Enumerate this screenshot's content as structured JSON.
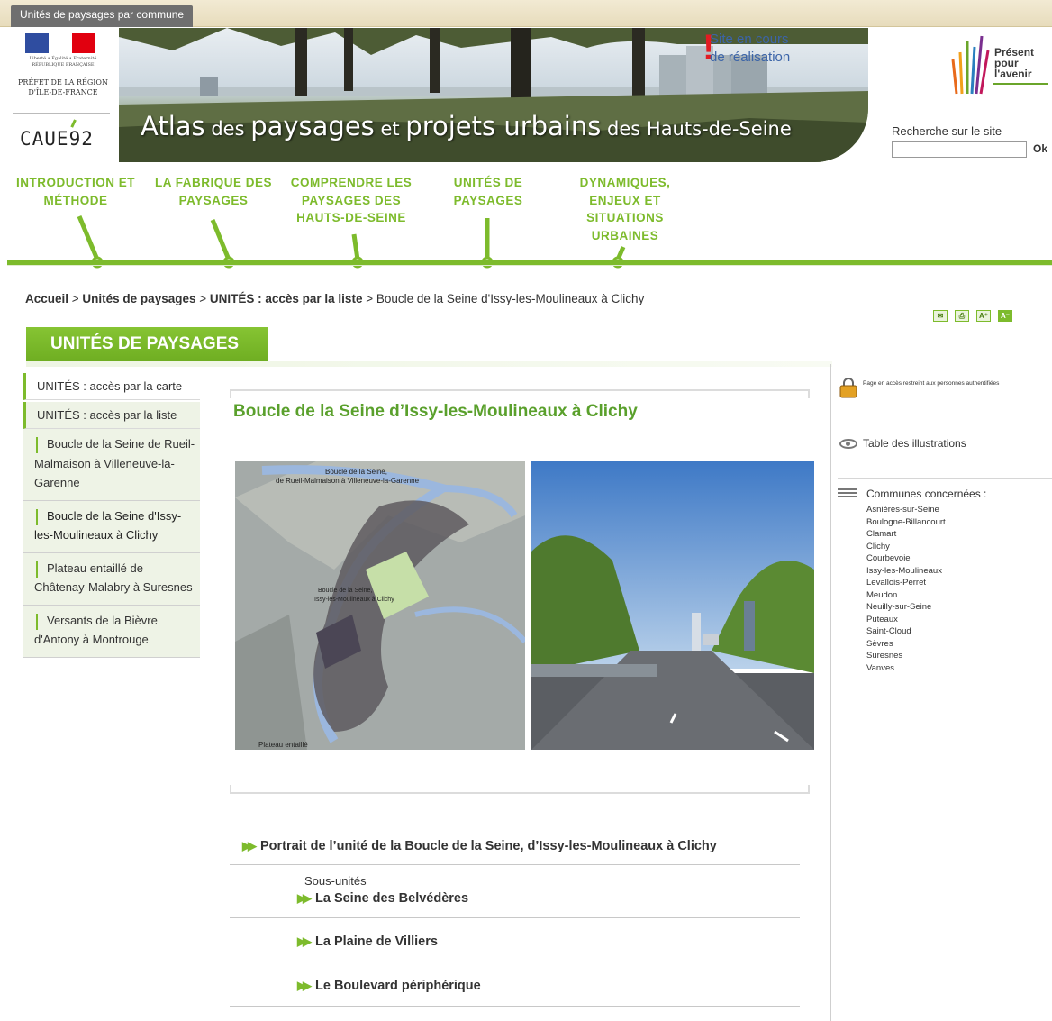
{
  "top_tab": "Unités de paysages par commune",
  "logo": {
    "motto": "Liberté • Égalité • Fraternité",
    "rf": "RÉPUBLIQUE FRANÇAISE",
    "prefet": "PRÉFET DE LA RÉGION D'ÎLE-DE-FRANCE",
    "caue": "CAUE92"
  },
  "banner": {
    "w1": "Atlas",
    "w2": " des ",
    "w3": "paysages",
    "w4": " et ",
    "w5": "projets urbains",
    "w6": " des Hauts-de-Seine",
    "notice_line1": "Site en cours",
    "notice_line2": "de réalisation"
  },
  "present": {
    "l1": "Présent",
    "l2": "pour",
    "l3": "l'avenir"
  },
  "search": {
    "label": "Recherche sur le site",
    "value": "",
    "ok": "Ok"
  },
  "nav": [
    {
      "l1": "INTRODUCTION ET",
      "l2": "MÉTHODE"
    },
    {
      "l1": "LA FABRIQUE DES",
      "l2": "PAYSAGES"
    },
    {
      "l1": "COMPRENDRE LES",
      "l2": "PAYSAGES DES",
      "l3": "HAUTS-DE-SEINE"
    },
    {
      "l1": "UNITÉS DE",
      "l2": "PAYSAGES"
    },
    {
      "l1": "DYNAMIQUES,",
      "l2": "ENJEUX ET",
      "l3": "SITUATIONS",
      "l4": "URBAINES"
    }
  ],
  "breadcrumb": {
    "b1": "Accueil",
    "sep": " > ",
    "b2": "Unités de paysages",
    "b3": "UNITÉS : accès par la liste",
    "b4": "Boucle de la Seine d'Issy-les-Moulineaux à Clichy"
  },
  "tools": [
    "✉",
    "⎙",
    "A⁺",
    "A⁻"
  ],
  "section_title": "UNITÉS DE PAYSAGES",
  "sidebar": {
    "item1": "UNITÉS : accès par la carte",
    "item2": "UNITÉS : accès par la liste",
    "sub": [
      "Boucle de la Seine de Rueil-Malmaison à Villeneuve-la-Garenne",
      "Boucle de la Seine d'Issy-les-Moulineaux à Clichy",
      "Plateau entaillé de Châtenay-Malabry à Suresnes",
      "Versants de la Bièvre d'Antony à Montrouge"
    ]
  },
  "main": {
    "title": "Boucle de la Seine d’Issy-les-Moulineaux à Clichy",
    "map_labels": {
      "a1": "Boucle de la Seine,",
      "a2": "de Rueil-Malmaison à Villeneuve-la-Garenne",
      "b1": "Boucle de la Seine,",
      "b2": "Issy-les-Moulineaux à Clichy",
      "c": "Plateau entaillé"
    },
    "portrait": "Portrait de l’unité de la Boucle de la Seine, d’Issy-les-Moulineaux à Clichy",
    "sous_label": "Sous-unités",
    "subunits": [
      "La Seine des Belvédères",
      "La Plaine de Villiers",
      "Le Boulevard périphérique"
    ]
  },
  "right": {
    "lock_text": "Page en accès restreint aux personnes authentifiées",
    "illustrations": "Table des illustrations",
    "communes_label": "Communes concernées :",
    "communes": [
      "Asnières-sur-Seine",
      "Boulogne-Billancourt",
      "Clamart",
      "Clichy",
      "Courbevoie",
      "Issy-les-Moulineaux",
      "Levallois-Perret",
      "Meudon",
      "Neuilly-sur-Seine",
      "Puteaux",
      "Saint-Cloud",
      "Sèvres",
      "Suresnes",
      "Vanves"
    ]
  },
  "colors": {
    "accent": "#7dbb2c",
    "title_green": "#5aa02c",
    "notice_blue": "#3b64a8",
    "notice_red": "#e21c23"
  }
}
